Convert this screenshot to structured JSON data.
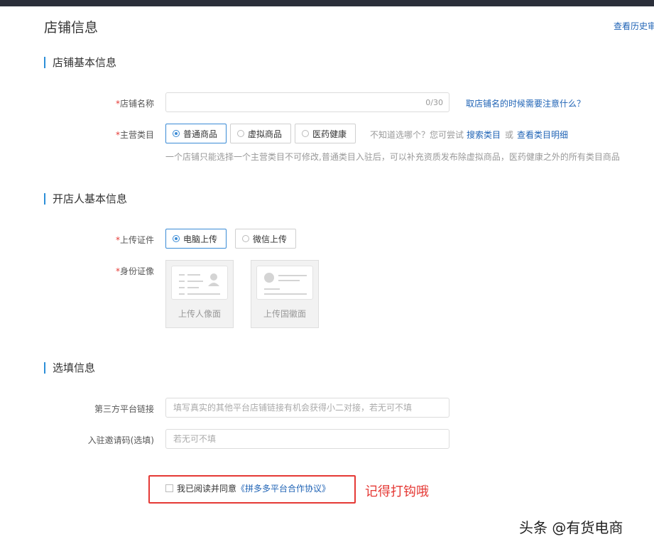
{
  "page": {
    "title": "店铺信息",
    "history_link": "查看历史审"
  },
  "sections": {
    "basic": "店铺基本信息",
    "owner": "开店人基本信息",
    "optional": "选填信息"
  },
  "store_name": {
    "required_mark": "*",
    "label": "店铺名称",
    "value": "",
    "counter": "0/30",
    "help_link": "取店铺名的时候需要注意什么？"
  },
  "category": {
    "required_mark": "*",
    "label": "主营类目",
    "options": [
      "普通商品",
      "虚拟商品",
      "医药健康"
    ],
    "selected": "普通商品",
    "prompt": "不知道选哪个？您可尝试",
    "search_link": "搜索类目",
    "or": "或",
    "detail_link": "查看类目明细",
    "note": "一个店铺只能选择一个主营类目不可修改,普通类目入驻后，可以补充资质发布除虚拟商品，医药健康之外的所有类目商品"
  },
  "upload_method": {
    "required_mark": "*",
    "label": "上传证件",
    "options": [
      "电脑上传",
      "微信上传"
    ],
    "selected": "电脑上传"
  },
  "id_card": {
    "required_mark": "*",
    "label": "身份证像",
    "front_text": "上传人像面",
    "back_text": "上传国徽面"
  },
  "third_party": {
    "label": "第三方平台链接",
    "placeholder": "填写真实的其他平台店铺链接有机会获得小二对接，若无可不填"
  },
  "invite_code": {
    "label": "入驻邀请码(选填)",
    "placeholder": "若无可不填"
  },
  "agreement": {
    "text": "我已阅读并同意",
    "link": "《拼多多平台合作协议》",
    "checked": false
  },
  "annotation": {
    "note": "记得打钩哦",
    "color": "#e53935"
  },
  "watermark": "头条 @有货电商",
  "colors": {
    "accent": "#2c8fd8",
    "link": "#1f63b5",
    "required": "#e53935"
  }
}
